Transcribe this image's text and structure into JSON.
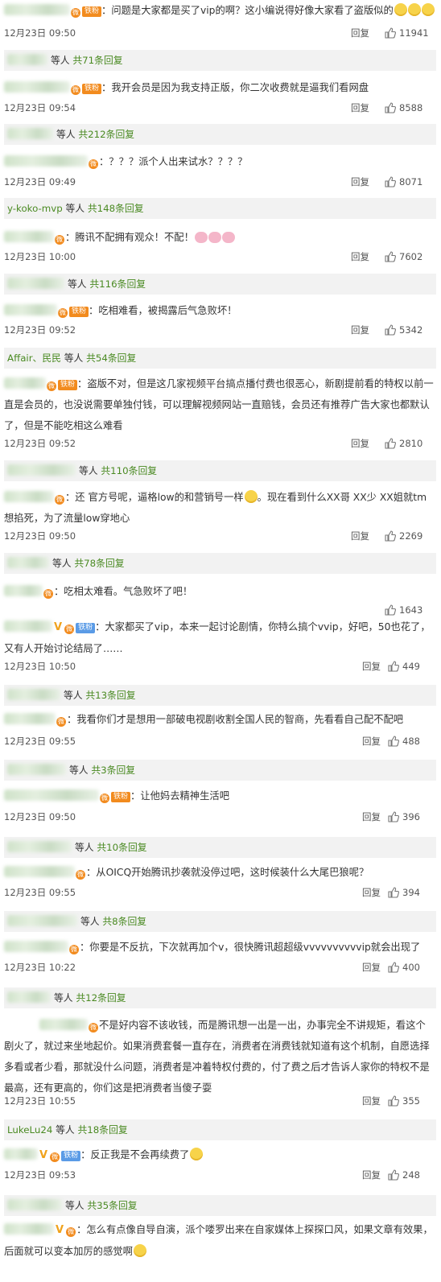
{
  "reply_word": "回复",
  "comments": [
    {
      "badge": "铁粉",
      "text": "：问题是大家都是买了vip的啊？这小编说得好像大家看了盗版似的",
      "emoji": 3,
      "time": "12月23日 09:50",
      "likes": "11941",
      "replies": {
        "user": "",
        "label": "等人",
        "count": "共71条回复"
      }
    },
    {
      "badge": "铁粉",
      "text": "：我开会员是因为我支持正版，你二次收费就是逼我们看网盘",
      "time": "12月23日 09:54",
      "likes": "8588",
      "replies": {
        "user": "",
        "label": "等人",
        "count": "共212条回复"
      }
    },
    {
      "badge": "",
      "text": "：？？？派个人出来试水？？？？",
      "time": "12月23日 09:49",
      "likes": "8071",
      "replies": {
        "user": "y-koko-mvp",
        "label": "等人",
        "count": "共148条回复"
      }
    },
    {
      "badge": "",
      "text": "：腾讯不配拥有观众！不配！",
      "pigs": 3,
      "time": "12月23日 10:00",
      "likes": "7602",
      "replies": {
        "user": "",
        "label": "等人",
        "count": "共116条回复"
      }
    },
    {
      "badge": "铁粉",
      "text": "：吃相难看，被揭露后气急败坏！",
      "time": "12月23日 09:52",
      "likes": "5342",
      "replies": {
        "user": "Affair、民民",
        "label": "等人",
        "count": "共54条回复"
      }
    },
    {
      "badge": "铁粉",
      "text": "：盗版不对，但是这几家视频平台搞点播付费也很恶心，新剧提前看的特权以前一直是会员的，也没说需要单独付钱，可以理解视频网站一直赔钱，会员还有推荐广告大家也都默认了，但是不能吃相这么难看",
      "time": "12月23日 09:52",
      "likes": "2810",
      "replies": {
        "user": "",
        "label": "等人",
        "count": "共110条回复"
      }
    },
    {
      "badge": "",
      "text": "：还 官方号呢，逼格low的和营销号一样",
      "emoji": 1,
      "text2": "。现在看到什么XX哥 XX少 XX姐就tm想掐死，为了流量low穿地心",
      "time": "12月23日 09:50",
      "likes": "2269",
      "replies": {
        "user": "",
        "label": "等人",
        "count": "共78条回复"
      }
    },
    {
      "badge": "",
      "text": "：吃相太难看。气急败坏了吧！",
      "time": "",
      "likes": "1643",
      "replies": null
    },
    {
      "badge": "铁粉",
      "vip": true,
      "text": "：大家都买了vip，本来一起讨论剧情，你特么搞个vvip，好吧，50也花了，又有人开始讨论结局了……",
      "time": "12月23日 10:50",
      "likes": "449",
      "replies": {
        "user": "",
        "label": "等人",
        "count": "共13条回复"
      }
    },
    {
      "badge": "",
      "text": "：我看你们才是想用一部破电视剧收割全国人民的智商，先看看自己配不配吧",
      "time": "12月23日 09:55",
      "likes": "488",
      "replies": {
        "user": "",
        "label": "等人",
        "count": "共3条回复"
      }
    },
    {
      "badge": "铁粉",
      "text": "：让他妈去精神生活吧",
      "time": "12月23日 09:50",
      "likes": "396",
      "replies": {
        "user": "",
        "label": "等人",
        "count": "共10条回复"
      }
    },
    {
      "badge": "",
      "text": "：从OICQ开始腾讯抄袭就没停过吧，这时候装什么大尾巴狼呢？",
      "time": "12月23日 09:55",
      "likes": "394",
      "replies": {
        "user": "",
        "label": "等人",
        "count": "共8条回复"
      }
    },
    {
      "badge": "",
      "text": "：你要是不反抗，下次就再加个v，很快腾讯超超级vvvvvvvvvvip就会出现了",
      "time": "12月23日 10:22",
      "likes": "400",
      "replies": {
        "user": "",
        "label": "等人",
        "count": "共12条回复"
      }
    },
    {
      "badge": "",
      "text": "不是好内容不该收钱，而是腾讯想一出是一出，办事完全不讲规矩，看这个剧火了，就过来坐地起价。如果消费套餐一直存在，消费者在消费钱就知道有这个机制，自愿选择多看或者少看，那就没什么问题，消费者是冲着特权付费的，付了费之后才告诉人家你的特权不是最高，还有更高的，你们这是把消费者当傻子耍",
      "time": "12月23日 10:55",
      "likes": "355",
      "replies": {
        "user": "LukeLu24",
        "label": "等人",
        "count": "共18条回复"
      }
    },
    {
      "badge": "铁粉",
      "vip": true,
      "text": "：反正我是不会再续费了",
      "emoji": 1,
      "time": "12月23日 09:53",
      "likes": "248",
      "replies": {
        "user": "",
        "label": "等人",
        "count": "共35条回复"
      }
    },
    {
      "badge": "",
      "vip": true,
      "text": "：怎么有点像自导自演，派个喽罗出来在自家媒体上探探口风，如果文章有效果，后面就可以变本加厉的感觉啊",
      "emoji": 1,
      "time": "",
      "likes": "",
      "replies": null
    }
  ]
}
